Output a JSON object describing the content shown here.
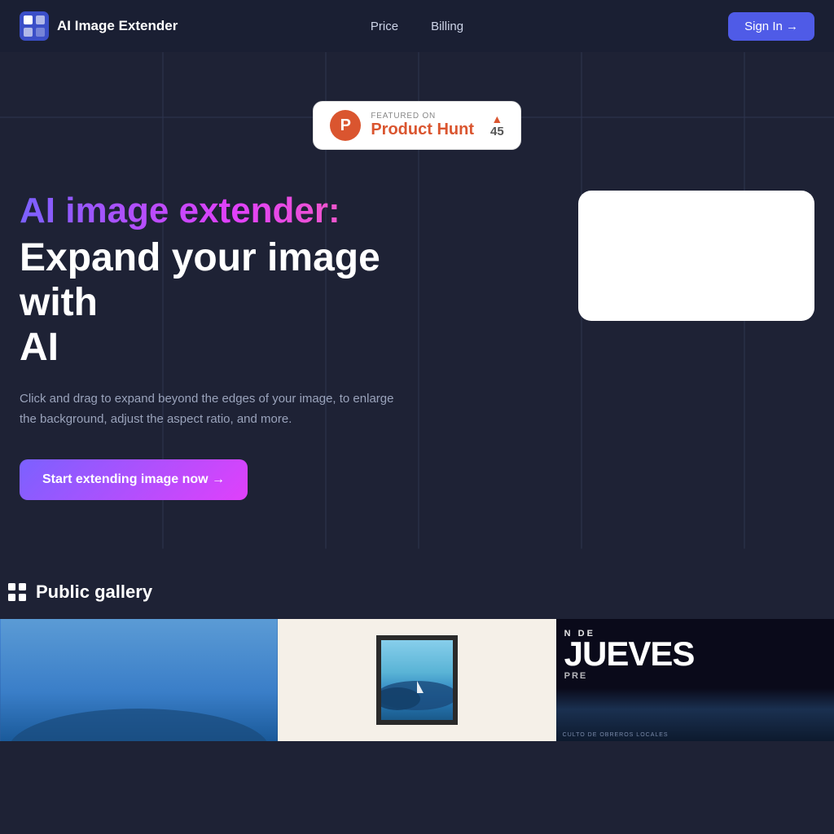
{
  "nav": {
    "logo_text": "AI Image Extender",
    "links": [
      {
        "label": "Price",
        "id": "price"
      },
      {
        "label": "Billing",
        "id": "billing"
      }
    ],
    "signin_label": "Sign In →"
  },
  "product_hunt": {
    "featured_on": "FEATURED ON",
    "name": "Product Hunt",
    "votes": "45"
  },
  "hero": {
    "title_gradient": "AI image extender:",
    "title_white_line1": "Expand your image with",
    "title_white_line2": "AI",
    "description": "Click and drag to expand beyond the edges of your image, to enlarge the background, adjust the aspect ratio, and more.",
    "cta_label": "Start extending image now →"
  },
  "gallery": {
    "section_title": "Public gallery"
  }
}
